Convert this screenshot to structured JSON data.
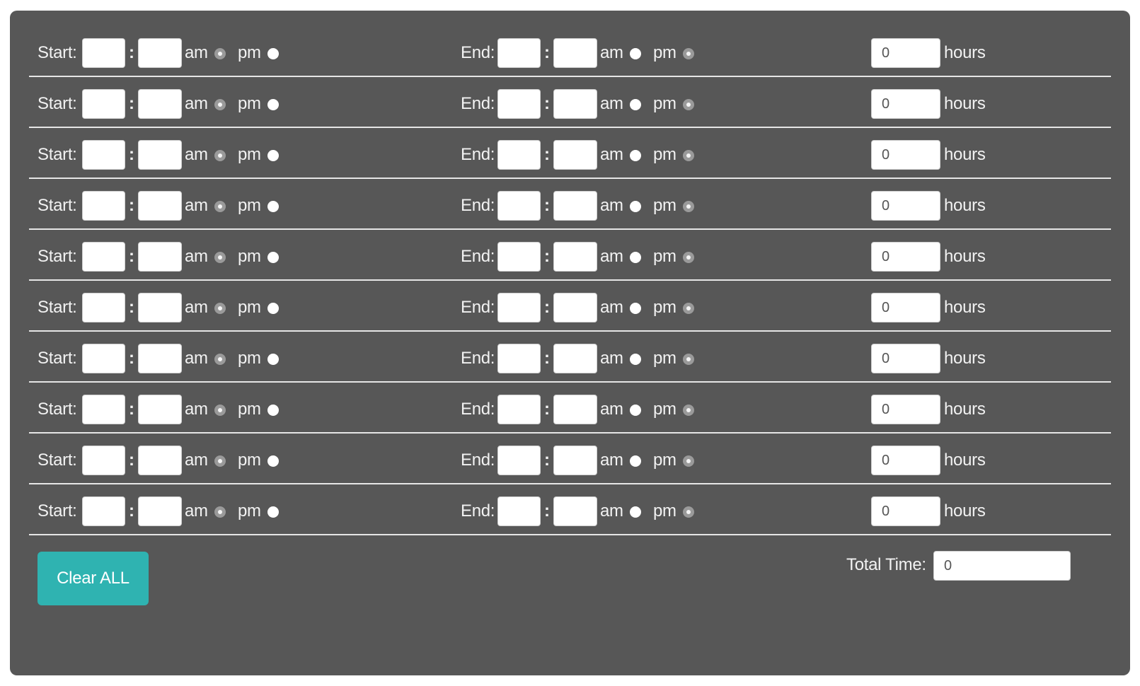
{
  "labels": {
    "start": "Start:",
    "end": "End:",
    "colon": ":",
    "am": "am",
    "pm": "pm",
    "hours": "hours"
  },
  "rows": [
    {
      "start_hour": "",
      "start_min": "",
      "start_period": "am",
      "end_hour": "",
      "end_min": "",
      "end_period": "pm",
      "hours": "0"
    },
    {
      "start_hour": "",
      "start_min": "",
      "start_period": "am",
      "end_hour": "",
      "end_min": "",
      "end_period": "pm",
      "hours": "0"
    },
    {
      "start_hour": "",
      "start_min": "",
      "start_period": "am",
      "end_hour": "",
      "end_min": "",
      "end_period": "pm",
      "hours": "0"
    },
    {
      "start_hour": "",
      "start_min": "",
      "start_period": "am",
      "end_hour": "",
      "end_min": "",
      "end_period": "pm",
      "hours": "0"
    },
    {
      "start_hour": "",
      "start_min": "",
      "start_period": "am",
      "end_hour": "",
      "end_min": "",
      "end_period": "pm",
      "hours": "0"
    },
    {
      "start_hour": "",
      "start_min": "",
      "start_period": "am",
      "end_hour": "",
      "end_min": "",
      "end_period": "pm",
      "hours": "0"
    },
    {
      "start_hour": "",
      "start_min": "",
      "start_period": "am",
      "end_hour": "",
      "end_min": "",
      "end_period": "pm",
      "hours": "0"
    },
    {
      "start_hour": "",
      "start_min": "",
      "start_period": "am",
      "end_hour": "",
      "end_min": "",
      "end_period": "pm",
      "hours": "0"
    },
    {
      "start_hour": "",
      "start_min": "",
      "start_period": "am",
      "end_hour": "",
      "end_min": "",
      "end_period": "pm",
      "hours": "0"
    },
    {
      "start_hour": "",
      "start_min": "",
      "start_period": "am",
      "end_hour": "",
      "end_min": "",
      "end_period": "pm",
      "hours": "0"
    }
  ],
  "footer": {
    "clear_label": "Clear ALL",
    "total_label": "Total Time:",
    "total_value": "0"
  },
  "colors": {
    "panel": "#575757",
    "accent": "#2fb3b1"
  }
}
